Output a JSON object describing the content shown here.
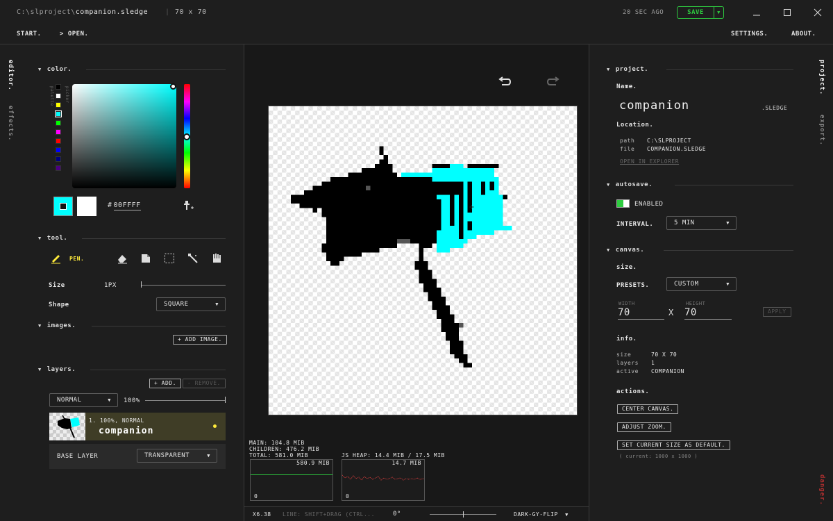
{
  "titlebar": {
    "path_prefix": "C:\\slproject\\",
    "file_name": "companion.sledge",
    "separator": "|",
    "dims": "70 x 70",
    "saved_ago": "20 SEC AGO",
    "save_label": "SAVE"
  },
  "menu": {
    "start": "START.",
    "open": "> OPEN.",
    "settings": "SETTINGS.",
    "about": "ABOUT."
  },
  "left_tabs": {
    "editor": "editor.",
    "effects": "effects."
  },
  "right_tabs": {
    "project": "project.",
    "export": "export.",
    "danger": "danger."
  },
  "color": {
    "section": "color.",
    "palette_label": "palette",
    "picker_label": "picker",
    "palette": [
      "#000000",
      "#ffffff",
      "#ffff00",
      "#00ffff",
      "#00ff00",
      "#ff00ff",
      "#ff0000",
      "#0000ff",
      "#000080",
      "#4b0082"
    ],
    "hex_prefix": "#",
    "hex": "00ffff",
    "primary": "#00ffff",
    "secondary": "#ffffff"
  },
  "tool": {
    "section": "tool.",
    "active": "PEN.",
    "size_label": "Size",
    "size_value": "1PX",
    "shape_label": "Shape",
    "shape_value": "SQUARE"
  },
  "images": {
    "section": "images.",
    "add": "+ ADD IMAGE."
  },
  "layers": {
    "section": "layers.",
    "add": "+ ADD.",
    "remove": "- REMOVE.",
    "blend": "NORMAL",
    "opacity": "100%",
    "items": [
      {
        "meta": "1. 100%, NORMAL",
        "name": "companion"
      }
    ],
    "base_label": "BASE LAYER",
    "base_value": "TRANSPARENT"
  },
  "stats": {
    "main": "MAIN: 104.8 MIB",
    "children": "CHILDREN: 476.2 MIB",
    "total": "TOTAL: 581.0 MIB",
    "heap": "JS HEAP: 14.4 MIB / 17.5 MIB",
    "graph1_max": "580.9 MIB",
    "graph2_max": "14.7 MIB",
    "zero": "0"
  },
  "status": {
    "zoom": "X6.38",
    "hint": "LINE: SHIFT+DRAG (CTRL...",
    "rotation": "0°",
    "theme": "DARK-GY-FLIP"
  },
  "project": {
    "section": "project.",
    "name_label": "Name.",
    "name": "companion",
    "ext": ".SLEDGE",
    "location_label": "Location.",
    "path_key": "path",
    "path_val": "C:\\SLPROJECT",
    "file_key": "file",
    "file_val": "COMPANION.SLEDGE",
    "open_explorer": "OPEN IN EXPLORER"
  },
  "autosave": {
    "section": "autosave.",
    "enabled": "ENABLED",
    "interval_label": "INTERVAL.",
    "interval": "5 MIN"
  },
  "canvas": {
    "section": "canvas.",
    "size_label": "size.",
    "presets_label": "PRESETS.",
    "presets": "CUSTOM",
    "width_label": "WIDTH",
    "height_label": "HEIGHT",
    "width": "70",
    "height": "70",
    "times": "X",
    "apply": "APPLY",
    "info_label": "info.",
    "info_size_key": "size",
    "info_size": "70 X 70",
    "info_layers_key": "layers",
    "info_layers": "1",
    "info_active_key": "active",
    "info_active": "COMPANION",
    "actions_label": "actions.",
    "center": "CENTER CANVAS.",
    "adjust": "ADJUST ZOOM.",
    "set_default": "SET CURRENT SIZE AS DEFAULT.",
    "current": "( current: 1000 x 1000 )"
  }
}
